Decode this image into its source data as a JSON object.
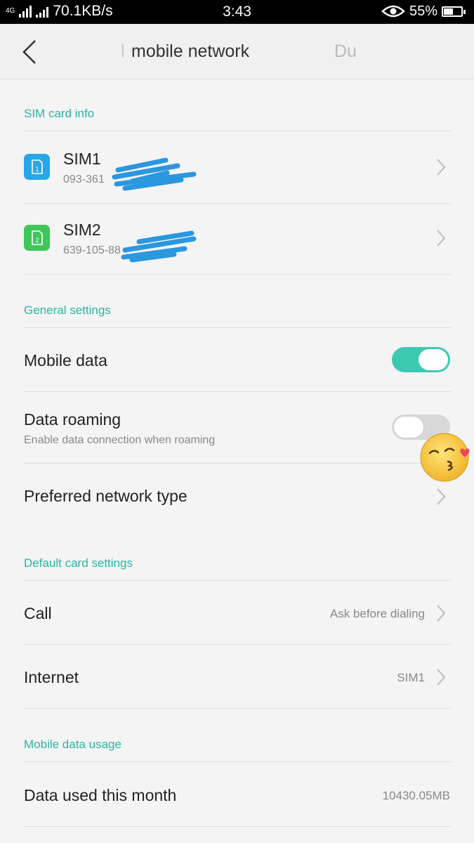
{
  "status_bar": {
    "network_type": "4G",
    "speed": "70.1KB/s",
    "time": "3:43",
    "battery": "55%",
    "battery_level": 0.55,
    "icons": [
      "signal-icon",
      "eye-icon",
      "battery-icon"
    ]
  },
  "header": {
    "prev_title_fragment": "l",
    "title": "mobile network",
    "next_title_fragment": "Du"
  },
  "sim_section": {
    "label": "SIM card info",
    "sims": [
      {
        "name": "SIM1",
        "number": "093-361",
        "icon_color": "#29a6e6",
        "icon_digit": "1"
      },
      {
        "name": "SIM2",
        "number": "639-105-88",
        "icon_color": "#3ec65a",
        "icon_digit": "2"
      }
    ]
  },
  "general_section": {
    "label": "General settings",
    "mobile_data": {
      "label": "Mobile data",
      "enabled": true
    },
    "data_roaming": {
      "label": "Data roaming",
      "sublabel": "Enable data connection when roaming",
      "enabled": false
    },
    "preferred_network": {
      "label": "Preferred network type"
    }
  },
  "default_card_section": {
    "label": "Default card settings",
    "call": {
      "label": "Call",
      "value": "Ask before dialing"
    },
    "internet": {
      "label": "Internet",
      "value": "SIM1"
    }
  },
  "usage_section": {
    "label": "Mobile data usage",
    "data_used": {
      "label": "Data used this month",
      "value": "10430.05MB"
    }
  },
  "colors": {
    "accent": "#2ab4a4",
    "toggle_on": "#3cc9b2",
    "redaction": "#2b97df"
  }
}
